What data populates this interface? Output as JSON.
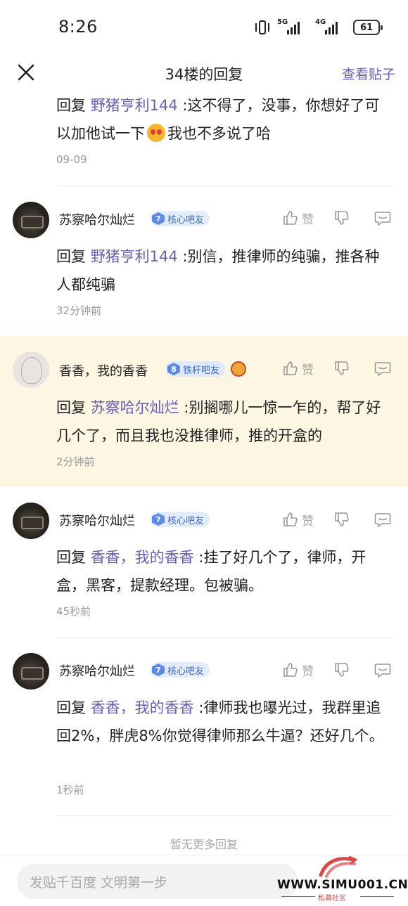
{
  "status_bar": {
    "time": "8:26",
    "net1": "5G",
    "net2": "4G",
    "battery": "61"
  },
  "header": {
    "title": "34楼的回复",
    "view_post": "查看贴子"
  },
  "partial_reply": {
    "prefix": "回复 ",
    "mention": "野猪亨利144",
    "text_before_emoji": " :这不得了，没事，你想好了可以加他试一下",
    "text_after_emoji": "我也不多说了哈",
    "time": "09-09"
  },
  "comments": [
    {
      "username": "苏察哈尔灿烂",
      "badge_level": "7",
      "badge_label": "核心吧友",
      "like_label": "赞",
      "prefix": "回复 ",
      "mention": "野猪亨利144",
      "text": " :别信，推律师的纯骗，推各种人都纯骗",
      "time": "32分钟前"
    },
    {
      "username": "香香，我的香香",
      "badge_level": "8",
      "badge_label": "铁杆吧友",
      "like_label": "赞",
      "prefix": "回复 ",
      "mention": "苏察哈尔灿烂",
      "text": " :别搁哪儿一惊一乍的，帮了好几个了，而且我也没推律师，推的开盒的",
      "time": "2分钟前"
    },
    {
      "username": "苏察哈尔灿烂",
      "badge_level": "7",
      "badge_label": "核心吧友",
      "like_label": "赞",
      "prefix": "回复 ",
      "mention": "香香，我的香香",
      "text": " :挂了好几个了，律师，开盒，黑客，提款经理。包被骗。",
      "time": "45秒前"
    },
    {
      "username": "苏察哈尔灿烂",
      "badge_level": "7",
      "badge_label": "核心吧友",
      "like_label": "赞",
      "prefix": "回复 ",
      "mention": "香香，我的香香",
      "text": " :律师我也曝光过，我群里追回2%，胖虎8%你觉得律师那么牛逼？还好几个。",
      "time": "1秒前"
    }
  ],
  "footer": {
    "no_more": "暂无更多回复",
    "input_placeholder": "发贴千百度 文明第一步"
  },
  "watermark": {
    "url": "WWW.SIMU001.CN",
    "sub": "私募社区"
  },
  "colors": {
    "accent": "#6a5bb8",
    "highlight_bg": "#fdf6e3",
    "badge_blue": "#5b8be6"
  }
}
